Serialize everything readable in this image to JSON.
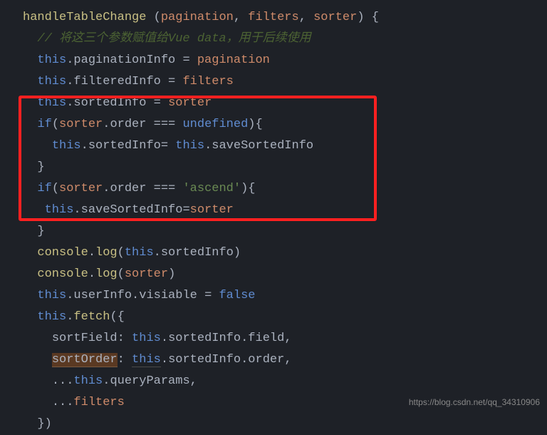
{
  "code": {
    "l1": {
      "func": "handleTableChange",
      "p1": "pagination",
      "p2": "filters",
      "p3": "sorter"
    },
    "l2": {
      "comment": "// 将这三个参数赋值给Vue data，用于后续使用"
    },
    "l3": {
      "prop": "paginationInfo",
      "val": "pagination"
    },
    "l4": {
      "prop": "filteredInfo",
      "val": "filters"
    },
    "l5": {
      "prop": "sortedInfo",
      "val": "sorter"
    },
    "l6": {
      "kw": "if",
      "param": "sorter",
      "prop": "order",
      "undef": "undefined"
    },
    "l7": {
      "prop": "sortedInfo",
      "prop2": "saveSortedInfo"
    },
    "l8": {
      "brace": "}"
    },
    "l9": {
      "kw": "if",
      "param": "sorter",
      "prop": "order",
      "str": "'ascend'"
    },
    "l10": {
      "prop": "saveSortedInfo",
      "val": "sorter"
    },
    "l11": {
      "brace": "}"
    },
    "l12": {
      "obj": "console",
      "method": "log",
      "prop": "sortedInfo"
    },
    "l13": {
      "obj": "console",
      "method": "log",
      "val": "sorter"
    },
    "l14": {
      "prop": "userInfo",
      "prop2": "visiable",
      "val": "false"
    },
    "l15": {
      "method": "fetch"
    },
    "l16": {
      "key": "sortField",
      "prop": "sortedInfo",
      "prop2": "field"
    },
    "l17": {
      "key": "sortOrder",
      "prop": "sortedInfo",
      "prop2": "order"
    },
    "l18": {
      "prop": "queryParams"
    },
    "l19": {
      "val": "filters"
    },
    "l20": {
      "brace": "})"
    }
  },
  "watermark": "https://blog.csdn.net/qq_34310906"
}
